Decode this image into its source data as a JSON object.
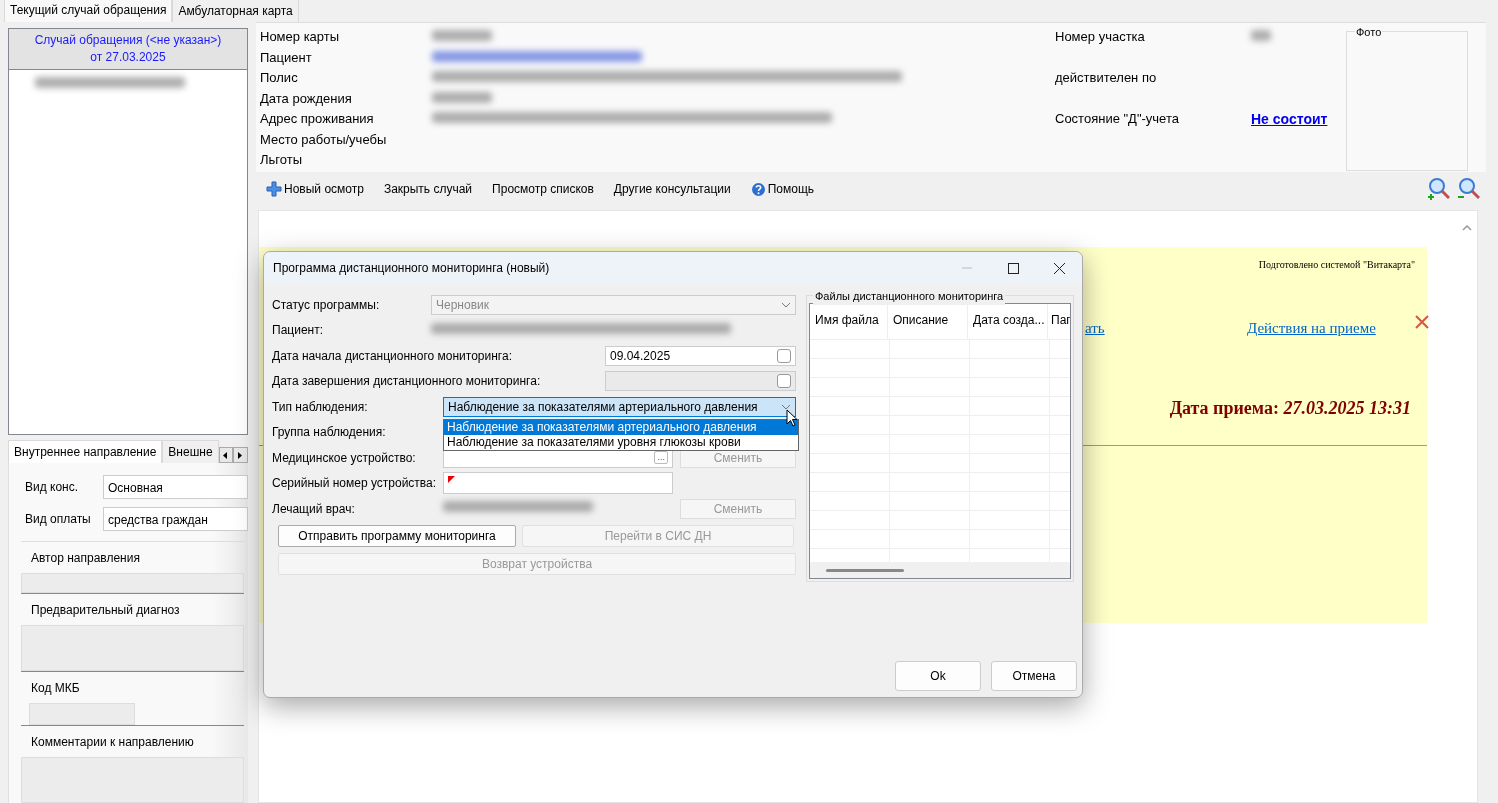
{
  "tabs": [
    {
      "label": "Текущий случай обращения",
      "selected": true
    },
    {
      "label": "Амбулаторная карта",
      "selected": false
    }
  ],
  "case_panel": {
    "header_line1": "Случай обращения (<не указан>)",
    "header_line2": "от 27.03.2025"
  },
  "bottom_tabs": [
    {
      "label": "Внутреннее направление",
      "selected": true
    },
    {
      "label": "Внешне",
      "selected": false
    }
  ],
  "referral_form": {
    "fields": [
      {
        "label": "Вид конс.",
        "value": "Основная"
      },
      {
        "label": "Вид оплаты",
        "value": "средства граждан"
      }
    ],
    "sections": [
      {
        "label": "Автор направления",
        "kind": "field"
      },
      {
        "label": "Предварительный диагноз",
        "kind": "area"
      },
      {
        "label": "Код МКБ",
        "kind": "short"
      },
      {
        "label": "Комментарии к направлению",
        "kind": "area"
      }
    ]
  },
  "patient_info": {
    "left": [
      {
        "label": "Номер карты",
        "kind": "blurred"
      },
      {
        "label": "Пациент",
        "kind": "blurredlink"
      },
      {
        "label": "Полис",
        "kind": "blurred"
      },
      {
        "label": "Дата рождения",
        "kind": "blurred"
      },
      {
        "label": "Адрес проживания",
        "kind": "blurred"
      },
      {
        "label": "Место работы/учебы",
        "kind": "empty"
      },
      {
        "label": "Льготы",
        "kind": "empty"
      }
    ],
    "right": [
      {
        "label": "Номер участка",
        "kind": "blurred"
      },
      {
        "label": "действителен по",
        "kind": "empty"
      },
      {
        "label": "Состояние \"Д\"-учета",
        "kind": "link",
        "link": "Не состоит"
      }
    ],
    "photo_legend": "Фото"
  },
  "toolbar": {
    "items": [
      {
        "label": "Новый осмотр",
        "kind": "plus"
      },
      {
        "label": "Закрыть случай",
        "kind": "plain"
      },
      {
        "label": "Просмотр списков",
        "kind": "plain"
      },
      {
        "label": "Другие консультации",
        "kind": "plain"
      },
      {
        "label": "Помощь",
        "kind": "help"
      }
    ]
  },
  "document": {
    "note": "Подготовлено системой \"Витакарта\"",
    "partial_link": "ать",
    "actions_link": "Действия на приеме",
    "date_line": "Дата приема: *27.03.2025 13:31*"
  },
  "dialog": {
    "title": "Программа дистанционного мониторинга (новый)",
    "fields": [
      {
        "kind": "select",
        "label": "Статус программы:",
        "value": "Черновик",
        "disabled": true
      },
      {
        "kind": "blurred",
        "label": "Пациент:"
      },
      {
        "kind": "date",
        "label": "Дата начала дистанционного мониторинга:",
        "value": "09.04.2025",
        "disabled": false
      },
      {
        "kind": "date",
        "label": "Дата завершения дистанционного мониторинга:",
        "disabled": true
      },
      {
        "kind": "select",
        "label": "Тип наблюдения:",
        "value": "Наблюдение за показателями артериального давления",
        "disabled": false,
        "expanded": true
      },
      {
        "kind": "empty",
        "label": "Группа наблюдения:"
      },
      {
        "kind": "picker",
        "label": "Медицинское устройство:",
        "picker_button": "...",
        "button": "Сменить",
        "button_disabled": true
      },
      {
        "kind": "text",
        "label": "Серийный номер устройства:",
        "required": true
      },
      {
        "kind": "blurred_button",
        "label": "Лечащий врач:",
        "button": "Сменить",
        "button_disabled": true
      }
    ],
    "actions": [
      {
        "label": "Отправить программу мониторинга",
        "disabled": false
      },
      {
        "label": "Перейти в СИС ДН",
        "disabled": true
      }
    ],
    "return_button": {
      "label": "Возврат устройства",
      "disabled": true
    },
    "dropdown_options": [
      {
        "label": "Наблюдение за показателями артериального давления",
        "selected": true
      },
      {
        "label": "Наблюдение за показателями уровня глюкозы крови",
        "selected": false
      }
    ],
    "files": {
      "legend": "Файлы дистанционного мониторинга",
      "columns": [
        "Имя файла",
        "Описание",
        "Дата созда...",
        "Паг"
      ]
    },
    "buttons": [
      "Ok",
      "Отмена"
    ]
  }
}
